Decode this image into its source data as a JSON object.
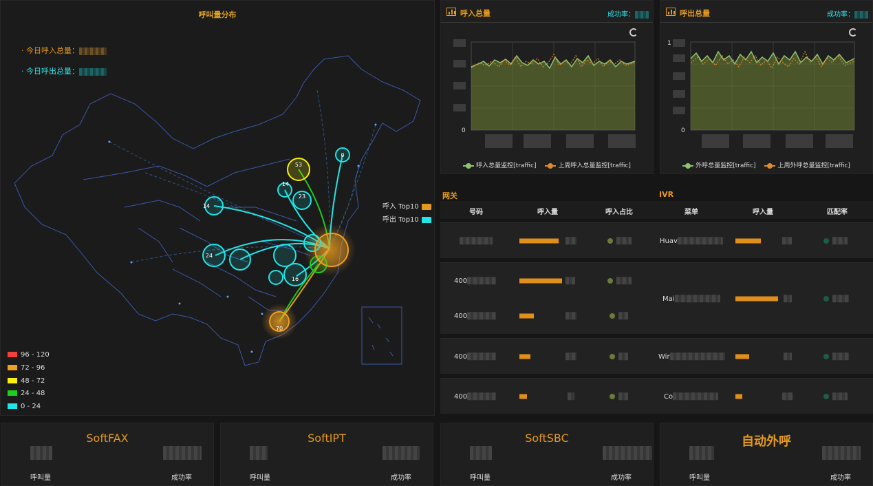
{
  "map": {
    "title": "呼叫量分布",
    "today_in_label": "今日呼入总量：",
    "today_out_label": "今日呼出总量：",
    "legend_in": "呼入 Top10",
    "legend_out": "呼出 Top10",
    "ranges": [
      {
        "label": "96 - 120",
        "color": "#f2403a"
      },
      {
        "label": "72 - 96",
        "color": "#f0a020"
      },
      {
        "label": "48 - 72",
        "color": "#f7f00c"
      },
      {
        "label": "24 - 48",
        "color": "#1ecb1e"
      },
      {
        "label": "0 - 24",
        "color": "#1fe6e8"
      }
    ],
    "bubbles": [
      "53",
      "14",
      "23",
      "14",
      "24",
      "16",
      "70",
      "0"
    ]
  },
  "chart_in": {
    "title": "呼入总量",
    "rate_label": "成功率：",
    "y_ticks": [
      "0"
    ],
    "legend": [
      "呼入总量监控[traffic]",
      "上周呼入总量监控[traffic]"
    ]
  },
  "chart_out": {
    "title": "呼出总量",
    "rate_label": "成功率：",
    "y_ticks": [
      "1",
      "0"
    ],
    "legend": [
      "外呼总量监控[traffic]",
      "上周外呼总量监控[traffic]"
    ]
  },
  "gateway": {
    "title": "网关",
    "headers": [
      "号码",
      "呼入量",
      "呼入占比"
    ],
    "rows": [
      "",
      "400",
      "400",
      "400",
      "400"
    ]
  },
  "ivr": {
    "title": "IVR",
    "headers": [
      "菜单",
      "呼入量",
      "匹配率"
    ],
    "rows": [
      "Huav",
      "Mai",
      "Wir",
      "Co"
    ]
  },
  "bottom": [
    {
      "name": "SoftFAX",
      "l1": "呼叫量",
      "l2": "成功率"
    },
    {
      "name": "SoftIPT",
      "l1": "呼叫量",
      "l2": "成功率"
    },
    {
      "name": "SoftSBC",
      "l1": "呼叫量",
      "l2": "成功率"
    },
    {
      "name": "自动外呼",
      "l1": "呼叫量",
      "l2": "成功率"
    }
  ],
  "colors": {
    "accent": "#e59a1e",
    "teal": "#2ee3e6",
    "green": "#7fb56a"
  }
}
